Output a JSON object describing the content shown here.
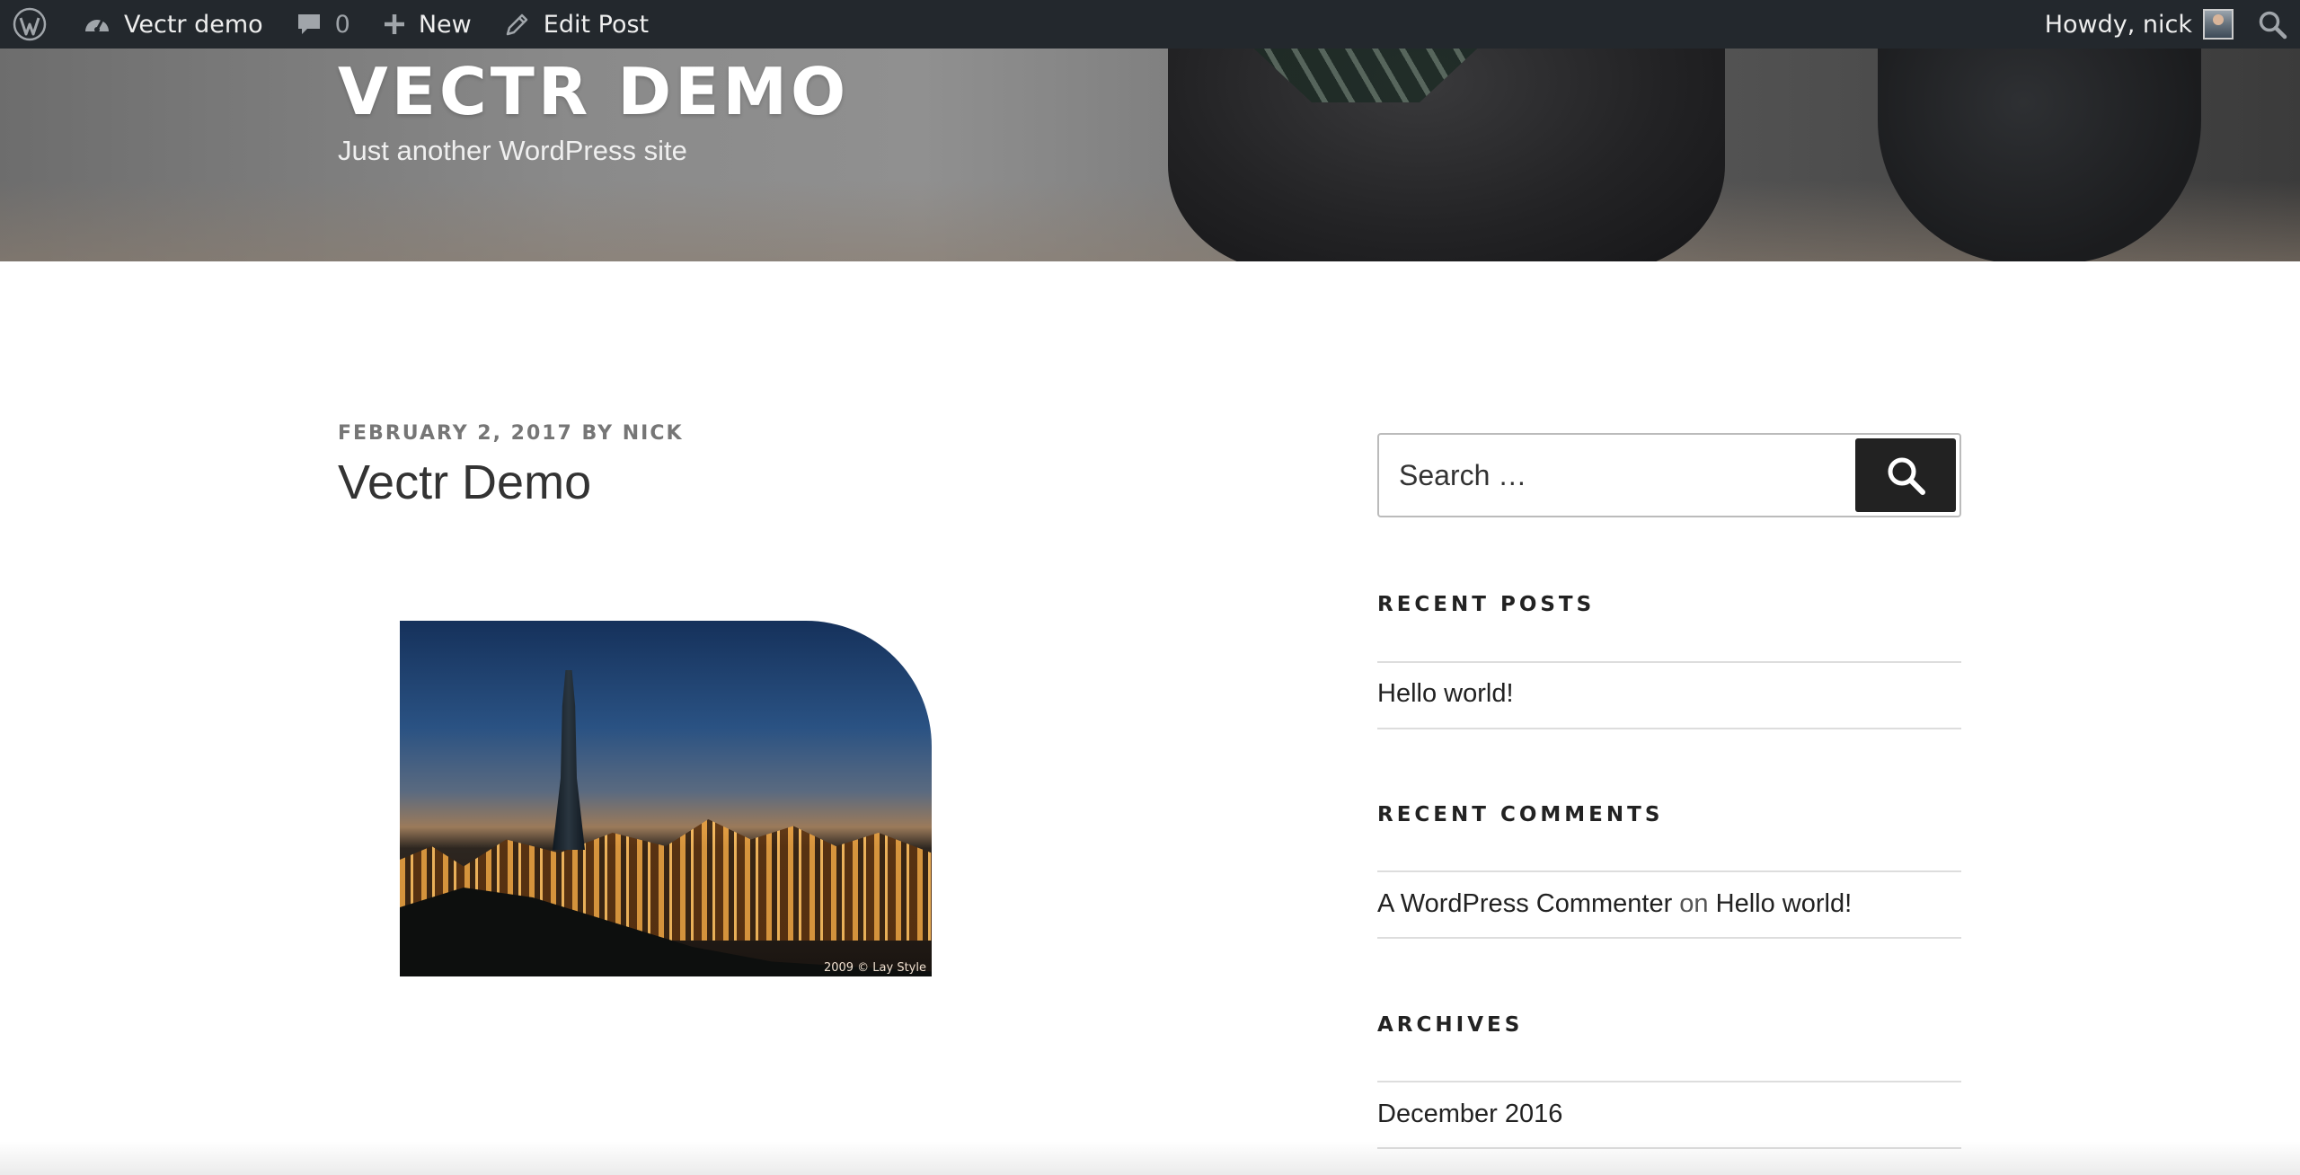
{
  "admin_bar": {
    "site_name": "Vectr demo",
    "comments_count": "0",
    "new_label": "New",
    "edit_label": "Edit Post",
    "greeting": "Howdy, nick"
  },
  "header": {
    "site_title": "VECTR DEMO",
    "tagline": "Just another WordPress site"
  },
  "post": {
    "date": "FEBRUARY 2, 2017",
    "by": "BY",
    "author": "NICK",
    "title": "Vectr Demo",
    "image_credit": "2009 © Lay Style"
  },
  "sidebar": {
    "search_placeholder": "Search …",
    "recent_posts": {
      "title": "RECENT POSTS",
      "items": [
        "Hello world!"
      ]
    },
    "recent_comments": {
      "title": "RECENT COMMENTS",
      "author": "A WordPress Commenter",
      "on": "on",
      "post": "Hello world!"
    },
    "archives": {
      "title": "ARCHIVES",
      "items": [
        "December 2016"
      ]
    }
  },
  "colors": {
    "admin_bar_bg": "#23282d",
    "search_button_bg": "#222222",
    "meta_text": "#767676"
  }
}
